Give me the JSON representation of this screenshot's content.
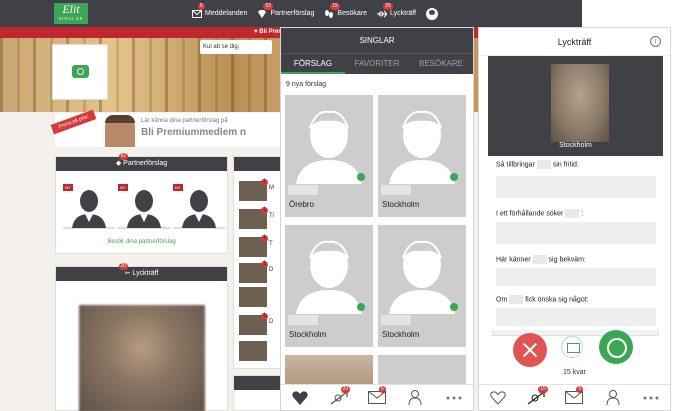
{
  "site": {
    "logo_text": "Elit",
    "logo_sub": "SINGLAR",
    "nav": [
      {
        "label": "Meddelanden",
        "badge": "5",
        "icon": "envelope-icon"
      },
      {
        "label": "Partnerförslag",
        "badge": "92",
        "icon": "diamond-icon"
      },
      {
        "label": "Besökare",
        "badge": "15",
        "icon": "footprints-icon"
      },
      {
        "label": "Lyckträff",
        "badge": "20",
        "icon": "arrow-heart-icon"
      }
    ],
    "promo_text": "Bli Premium-medlem nu",
    "hint_text": "Kul att se dig,",
    "premium": {
      "ribbon": "Prova på pris!",
      "small": "Lär känna dina partnerförslag på",
      "big": "Bli Premiummedlem n"
    },
    "partner_card": {
      "title": "Partnerförslag",
      "badge": "92",
      "new_label": "NY",
      "link": "Besök dina partnerförslag"
    },
    "lucky_card": {
      "title": "Lyckträff",
      "badge": "20"
    },
    "messages": [
      {
        "badge": "1",
        "text": "M"
      },
      {
        "badge": "1",
        "text": "Ti"
      },
      {
        "badge": "1",
        "text": "T"
      },
      {
        "badge": "1",
        "text": "D"
      },
      {
        "badge": "",
        "text": ""
      },
      {
        "badge": "1",
        "text": "D"
      },
      {
        "badge": "",
        "text": ""
      },
      {
        "badge": "",
        "text": ""
      }
    ]
  },
  "singlar": {
    "title": "SINGLAR",
    "tabs": [
      "FÖRSLAG",
      "FAVORITER",
      "BESÖKARE"
    ],
    "count_text": "9 nya förslag",
    "cards": [
      {
        "city": "Örebro",
        "online": true
      },
      {
        "city": "Stockholm",
        "online": true
      },
      {
        "city": "Stockholm",
        "online": true
      },
      {
        "city": "Stockholm",
        "online": true
      }
    ],
    "tabbar_badges": {
      "lucky": "20",
      "mail": "5"
    }
  },
  "lycktraff": {
    "title": "Lyckträff",
    "info": "i",
    "city": "Stockholm",
    "questions": [
      {
        "before": "Så tillbringar",
        "after": "sin fritid:"
      },
      {
        "before": "I ett förhållande söker",
        "after": ":"
      },
      {
        "before": "Här känner",
        "after": "sig bekväm:"
      },
      {
        "before": "Om",
        "after": "fick önska sig något:"
      }
    ],
    "remaining": "15 kvar",
    "tabbar_badges": {
      "lucky": "15",
      "mail": "5"
    }
  },
  "colors": {
    "dark": "#3f4147",
    "green": "#3ba653",
    "red": "#c0262f",
    "reject": "#e05552"
  }
}
